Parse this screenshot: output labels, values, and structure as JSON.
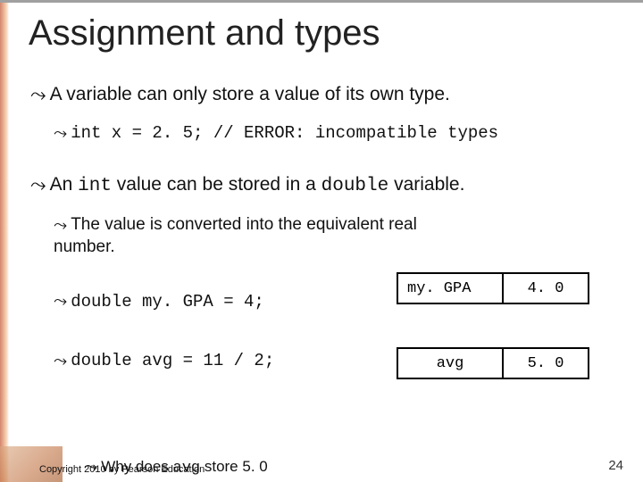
{
  "title": "Assignment and types",
  "bullets": {
    "a1": "A variable can only store a value of its own type.",
    "a2_code": "int x = 2. 5;     // ERROR: incompatible types",
    "b1_pre": "An ",
    "b1_code1": "int",
    "b1_mid": " value can be stored in a ",
    "b1_code2": "double",
    "b1_post": " variable.",
    "b2": "The value is converted into the equivalent real number.",
    "c1": "double my. GPA = 4;",
    "c2": "double avg = 11 / 2;",
    "cutoff_pre": "Why does ",
    "cutoff_code": "avg",
    "cutoff_post": " store 5. 0"
  },
  "boxes": {
    "gpa_label": "my. GPA",
    "gpa_value": "4. 0",
    "avg_label": "avg",
    "avg_value": "5. 0"
  },
  "footer": {
    "copyright": "Copyright 2010 by Pearson Education",
    "slidenum": "24"
  },
  "glyph": "⤳"
}
